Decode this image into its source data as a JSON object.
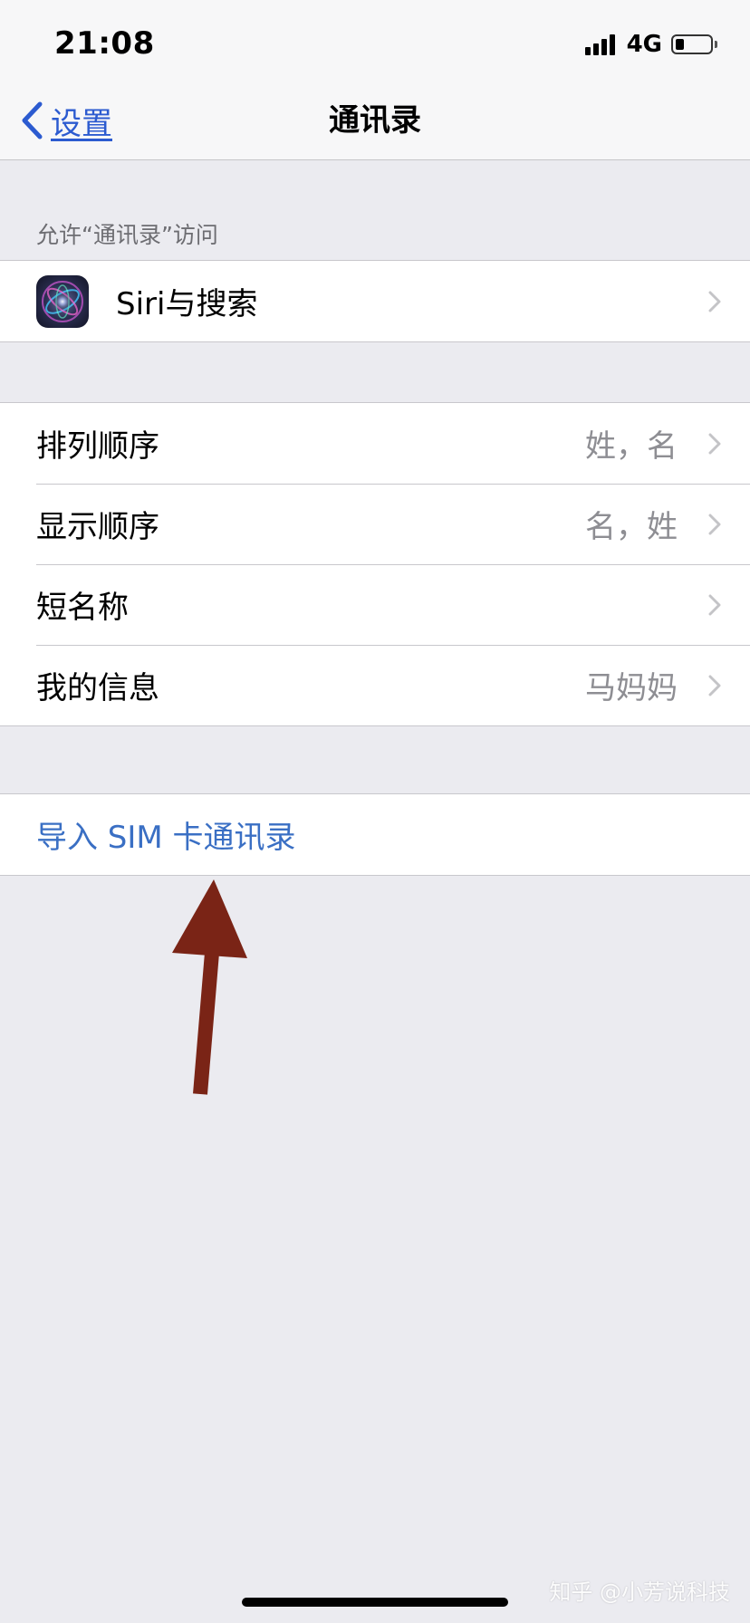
{
  "status_bar": {
    "time": "21:08",
    "network": "4G",
    "signal_bars": 4,
    "battery_level": 0.25
  },
  "nav": {
    "back_label": "设置",
    "title": "通讯录"
  },
  "sections": {
    "access_header": "允许“通讯录”访问",
    "siri_row": {
      "label": "Siri与搜索",
      "icon": "siri-icon"
    },
    "settings_rows": [
      {
        "label": "排列顺序",
        "value": "姓，名"
      },
      {
        "label": "显示顺序",
        "value": "名，姓"
      },
      {
        "label": "短名称",
        "value": ""
      },
      {
        "label": "我的信息",
        "value": "马妈妈"
      }
    ],
    "import_row": {
      "label": "导入 SIM 卡通讯录"
    }
  },
  "annotation": {
    "arrow_color": "#7a2416"
  },
  "watermark": "知乎 @小芳说科技",
  "colors": {
    "accent": "#2c5bd0",
    "link_blue": "#3a6fc4",
    "background": "#ebebf0",
    "secondary_text": "#8e8e93"
  }
}
